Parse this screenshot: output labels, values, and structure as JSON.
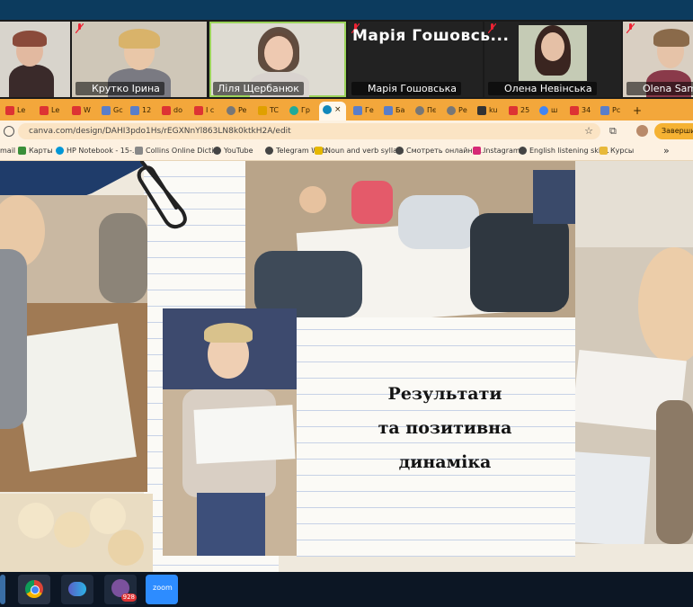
{
  "zoom": {
    "participants": [
      {
        "name": ""
      },
      {
        "name": "Крутко Ірина"
      },
      {
        "name": "Ліля Щербанюк"
      },
      {
        "name": "Марія Гошовська",
        "display": "Марія  Гошовсь..."
      },
      {
        "name": "Олена Невінська"
      },
      {
        "name": "Olena  Sam"
      }
    ]
  },
  "browser": {
    "tabs": [
      "Le",
      "Le",
      "W",
      "Gc",
      "12",
      "do",
      "I c",
      "Pe",
      "TC",
      "Гр",
      "",
      "Ге",
      "Ба",
      "Пє",
      "Ре",
      "ku",
      "25",
      "ш",
      "34",
      "Pc"
    ],
    "new_tab": "+",
    "url": "canva.com/design/DAHI3pdo1Hs/rEGXNnYl863LN8k0ktkH2A/edit",
    "finish_label": "Завершити",
    "bookmarks": [
      "mail",
      "Карты",
      "HP Notebook - 15-...",
      "Collins Online Dicti...",
      "YouTube",
      "Telegram Web",
      "Noun and verb sylla...",
      "Смотреть онлайн -...",
      "Instagram",
      "English listening skil...",
      "Курсы"
    ],
    "more": "»"
  },
  "slide": {
    "title_lines": [
      "Результати",
      "та позитивна",
      "динаміка"
    ]
  },
  "taskbar": {
    "teams_badge": "928",
    "zoom_label": "zoom"
  }
}
